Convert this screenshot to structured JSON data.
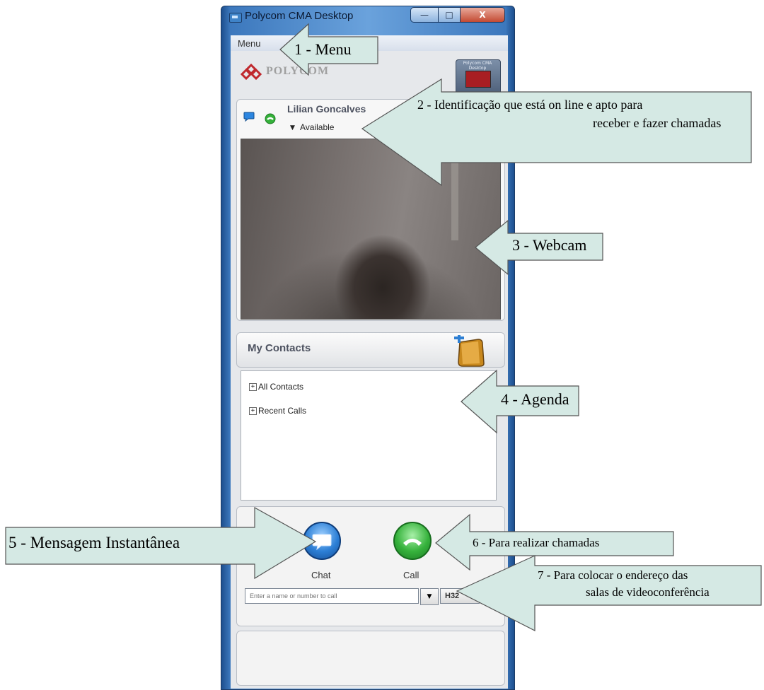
{
  "window": {
    "title": "Polycom CMA Desktop",
    "minimize_glyph": "—",
    "maximize_glyph": "□",
    "close_glyph": "X"
  },
  "menu": {
    "label": "Menu"
  },
  "brand": {
    "name": "POLYCOM",
    "badge_text": "Polycom CMA Desktop"
  },
  "presence": {
    "user_name": "Lilian Goncalves",
    "status": "Available",
    "caret": "▼"
  },
  "contacts": {
    "title": "My Contacts",
    "groups": [
      {
        "label": "All Contacts",
        "expander": "+"
      },
      {
        "label": "Recent Calls",
        "expander": "+"
      }
    ]
  },
  "call_panel": {
    "chat_label": "Chat",
    "call_label": "Call",
    "input_placeholder": "Enter a name or number to call",
    "dropdown_glyph": "▼",
    "protocol": "H32"
  },
  "annotations": {
    "menu": "1 - Menu",
    "status_line1": "2 - Identificação que está on line e apto para",
    "status_line2": "receber e fazer chamadas",
    "webcam": "3 - Webcam",
    "agenda": "4 - Agenda",
    "instant_message": "5 - Mensagem Instantânea",
    "calls": "6 - Para realizar chamadas",
    "address_line1": "7 - Para colocar o endereço das",
    "address_line2": "salas de videoconferência"
  },
  "colors": {
    "callout_fill": "#d5e9e4",
    "callout_stroke": "#555555",
    "window_frame": "#3c78bd"
  }
}
